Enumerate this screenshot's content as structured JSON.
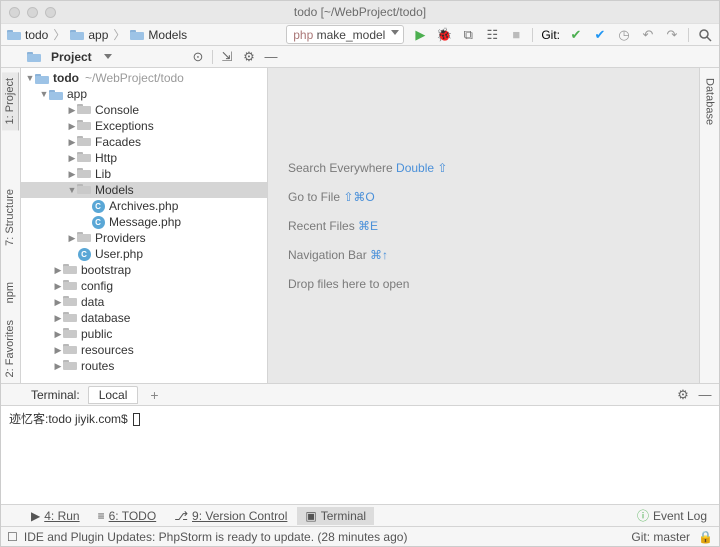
{
  "window": {
    "title": "todo [~/WebProject/todo]"
  },
  "breadcrumb": [
    "todo",
    "app",
    "Models"
  ],
  "run_config": {
    "label": "make_model",
    "prefix": "php"
  },
  "toolbar_actions": {
    "run": "▶",
    "debug": "🐞",
    "coverage": "⧉",
    "attach": "⇪",
    "stop": "■",
    "git_label": "Git:",
    "check": "✔",
    "arrow": "✔",
    "history": "⟳",
    "undo": "↶",
    "redo": "↷",
    "search": "🔍"
  },
  "project_toolbar": {
    "label": "Project"
  },
  "left_tabs": [
    "1: Project",
    "7: Structure",
    "2: Favorites",
    "npm"
  ],
  "right_tabs": [
    "Database"
  ],
  "tree": {
    "root": {
      "name": "todo",
      "path": "~/WebProject/todo"
    },
    "app": "app",
    "nodes": [
      {
        "name": "Console",
        "type": "dir",
        "depth": 3
      },
      {
        "name": "Exceptions",
        "type": "dir",
        "depth": 3
      },
      {
        "name": "Facades",
        "type": "dir",
        "depth": 3
      },
      {
        "name": "Http",
        "type": "dir",
        "depth": 3
      },
      {
        "name": "Lib",
        "type": "dir",
        "depth": 3
      },
      {
        "name": "Models",
        "type": "dir",
        "depth": 3,
        "open": true,
        "sel": true
      },
      {
        "name": "Archives.php",
        "type": "php",
        "depth": 4
      },
      {
        "name": "Message.php",
        "type": "php",
        "depth": 4
      },
      {
        "name": "Providers",
        "type": "dir",
        "depth": 3
      },
      {
        "name": "User.php",
        "type": "php",
        "depth": 3
      },
      {
        "name": "bootstrap",
        "type": "dir",
        "depth": 2
      },
      {
        "name": "config",
        "type": "dir",
        "depth": 2
      },
      {
        "name": "data",
        "type": "dir",
        "depth": 2
      },
      {
        "name": "database",
        "type": "dir",
        "depth": 2
      },
      {
        "name": "public",
        "type": "dir",
        "depth": 2
      },
      {
        "name": "resources",
        "type": "dir",
        "depth": 2
      },
      {
        "name": "routes",
        "type": "dir",
        "depth": 2
      }
    ]
  },
  "editor_hints": [
    {
      "label": "Search Everywhere ",
      "key": "Double ⇧"
    },
    {
      "label": "Go to File ",
      "key": "⇧⌘O"
    },
    {
      "label": "Recent Files ",
      "key": "⌘E"
    },
    {
      "label": "Navigation Bar ",
      "key": "⌘↑"
    },
    {
      "label": "Drop files here to open",
      "key": ""
    }
  ],
  "terminal": {
    "title": "Terminal:",
    "tab": "Local",
    "prompt": "迹忆客:todo jiyik.com$ "
  },
  "bottom_tabs": [
    {
      "label": "4: Run",
      "icon": "▶"
    },
    {
      "label": "6: TODO",
      "icon": "≡"
    },
    {
      "label": "9: Version Control",
      "icon": "⎇"
    },
    {
      "label": "Terminal",
      "icon": "▣",
      "active": true
    }
  ],
  "event_log": "Event Log",
  "status": {
    "msg": "IDE and Plugin Updates: PhpStorm is ready to update. (28 minutes ago)",
    "branch": "Git: master"
  }
}
